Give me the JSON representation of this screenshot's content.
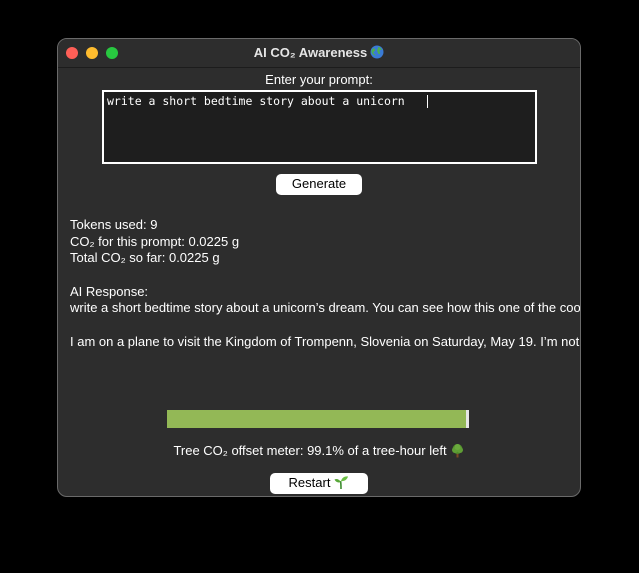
{
  "window": {
    "title": "AI CO₂ Awareness",
    "title_icon": "globe-icon"
  },
  "prompt": {
    "label": "Enter your prompt:",
    "value": "write a short bedtime story about a unicorn "
  },
  "generate_button": {
    "label": "Generate"
  },
  "stats": {
    "tokens": "Tokens used: 9",
    "co2_prompt": "CO₂ for this prompt: 0.0225 g",
    "co2_total": "Total CO₂ so far: 0.0225 g"
  },
  "response": {
    "label": "AI Response:",
    "paragraph1": "write a short bedtime story about a unicorn’s dream. You can see how this one of the coolest things I’ve ever owned.",
    "paragraph2": "I am on a plane to visit the Kingdom of Trompenn, Slovenia on Saturday, May 19. I’m not going to be there as soon as it returns to Croatia. I’m not going to be here just yet. On the way, I"
  },
  "meter": {
    "progress_fraction": 0.991,
    "label": "Tree CO₂ offset meter: 99.1% of a tree-hour left",
    "icon": "tree-icon",
    "fill_color": "#93b856",
    "track_color": "#e6e6e6"
  },
  "restart_button": {
    "label": "Restart",
    "icon": "sprout-icon"
  },
  "colors": {
    "window_bg": "#2d2d2d",
    "close": "#fe5f57",
    "minimize": "#febc2e",
    "maximize": "#28c840"
  }
}
